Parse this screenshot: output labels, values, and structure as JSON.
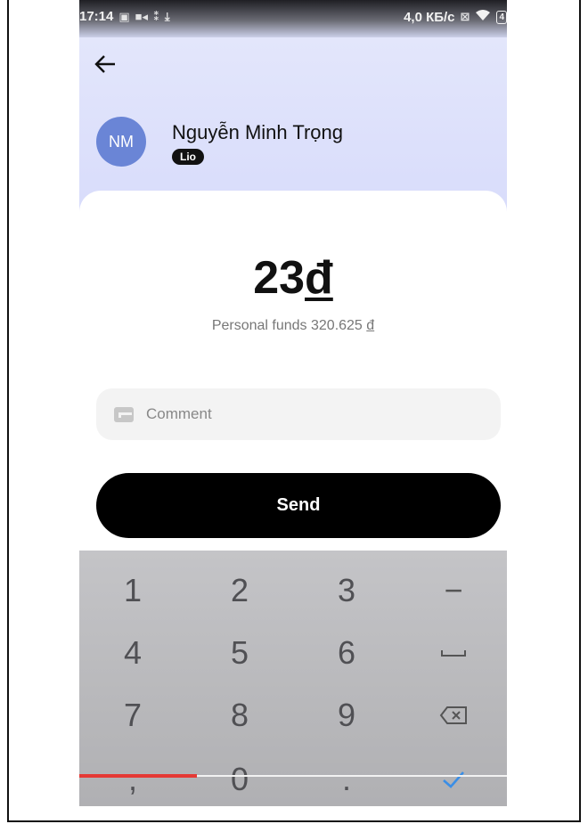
{
  "status_bar": {
    "time": "17:14",
    "left_icons": [
      "▣",
      "■◂",
      "⁑",
      "⤓"
    ],
    "speed": "4,0 КБ/с",
    "right_icons": [
      "⊠",
      "wifi-icon",
      "battery-icon"
    ],
    "battery": "4"
  },
  "recipient": {
    "initials": "NM",
    "name": "Nguyễn Minh Trọng",
    "badge": "Lio",
    "avatar_color": "#6a85d6"
  },
  "transfer": {
    "amount": "23",
    "currency_symbol": "đ",
    "funds_label": "Personal funds 320.625",
    "funds_currency": "đ"
  },
  "comment": {
    "placeholder": "Comment"
  },
  "send_button": {
    "label": "Send"
  },
  "keypad": {
    "keys": [
      [
        "1",
        "2",
        "3",
        "−"
      ],
      [
        "4",
        "5",
        "6",
        "␣"
      ],
      [
        "7",
        "8",
        "9",
        "⌫"
      ],
      [
        ",",
        "0",
        ".",
        "✓"
      ]
    ]
  },
  "colors": {
    "accent_check": "#3a8ee6",
    "red_indicator": "#e53935"
  }
}
